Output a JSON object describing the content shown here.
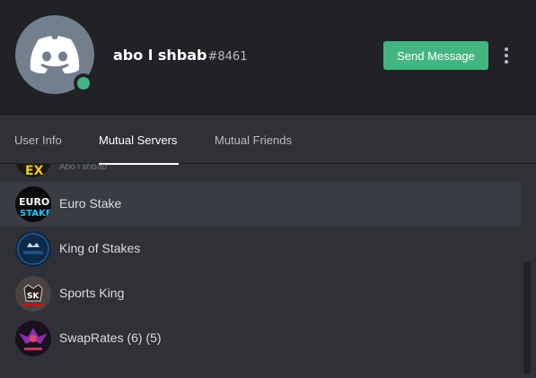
{
  "profile": {
    "username": "abo l shbab",
    "discriminator": "#8461",
    "status": "online",
    "send_message_label": "Send Message"
  },
  "tabs": [
    {
      "label": "User Info",
      "active": false
    },
    {
      "label": "Mutual Servers",
      "active": true
    },
    {
      "label": "Mutual Friends",
      "active": false
    }
  ],
  "servers": [
    {
      "name": "",
      "nickname": "Abo l shbab",
      "icon": "server-icon-partial"
    },
    {
      "name": "Euro Stake",
      "icon": "euro-stake-server-icon",
      "hover": true
    },
    {
      "name": "King of Stakes",
      "icon": "king-of-stakes-server-icon"
    },
    {
      "name": "Sports King",
      "icon": "sports-king-server-icon"
    },
    {
      "name": "SwapRates (6) (5)",
      "icon": "swaprates-server-icon"
    }
  ],
  "colors": {
    "header_bg": "#202225",
    "body_bg": "#2f3136",
    "online": "#43b581",
    "button": "#43b581",
    "avatar_bg": "#747f8d"
  }
}
